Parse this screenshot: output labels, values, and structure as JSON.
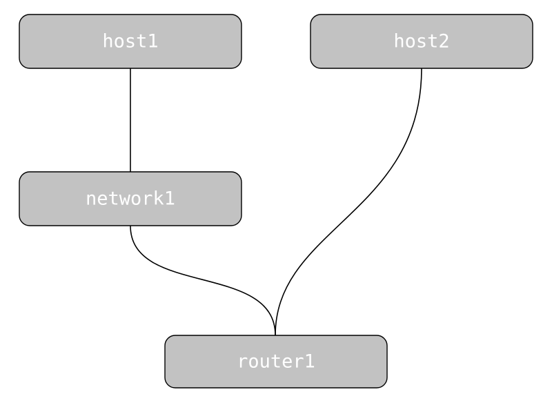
{
  "diagram": {
    "nodes": {
      "host1": "host1",
      "host2": "host2",
      "network1": "network1",
      "router1": "router1"
    },
    "edges": [
      {
        "from": "host1",
        "to": "network1"
      },
      {
        "from": "host2",
        "to": "router1"
      },
      {
        "from": "network1",
        "to": "router1"
      }
    ]
  }
}
